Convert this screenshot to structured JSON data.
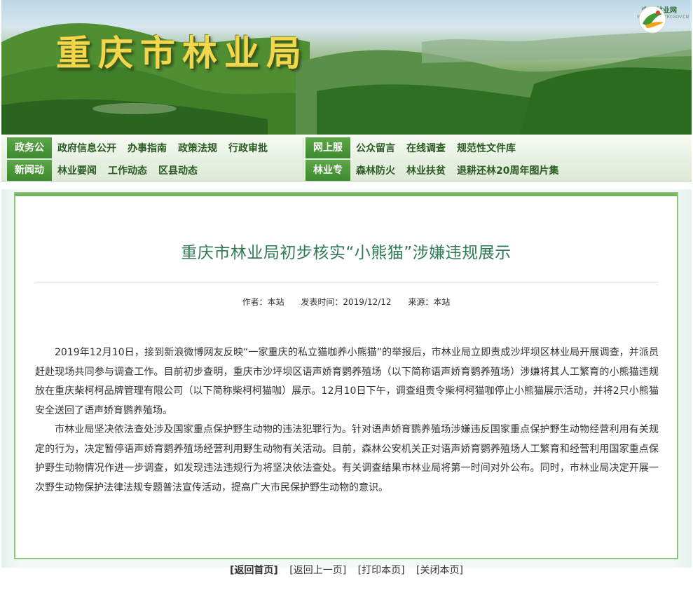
{
  "site": {
    "title": "重庆市林业局",
    "logo_name": "中国林业网",
    "logo_sub": "WWW.FORESTRY.GOV.CN"
  },
  "nav": {
    "row1": {
      "left_tag": "政务公开",
      "left_links": [
        "政府信息公开",
        "办事指南",
        "政策法规",
        "行政审批"
      ],
      "right_tag": "网上服务",
      "right_links": [
        "公众留言",
        "在线调查",
        "规范性文件库"
      ]
    },
    "row2": {
      "left_tag": "新闻动态",
      "left_links": [
        "林业要闻",
        "工作动态",
        "区县动态"
      ],
      "right_tag": "林业专题",
      "right_links": [
        "森林防火",
        "林业扶贫",
        "退耕还林20周年图片集"
      ]
    }
  },
  "article": {
    "title": "重庆市林业局初步核实“小熊猫”涉嫌违规展示",
    "author": "作者：本站",
    "date": "发表时间：2019/12/12",
    "source": "来源：本站",
    "paragraphs": [
      "2019年12月10日，接到新浪微博网友反映“一家重庆的私立猫咖养小熊猫”的举报后，市林业局立即责成沙坪坝区林业局开展调查，并派员赶赴现场共同参与调查工作。目前初步查明，重庆市沙坪坝区语声娇育鹦养殖场（以下简称语声娇育鹦养殖场）涉嫌将其人工繁育的小熊猫违规放在重庆柴柯柯品牌管理有限公司（以下简称柴柯柯猫咖）展示。12月10日下午，调查组责令柴柯柯猫咖停止小熊猫展示活动，并将2只小熊猫安全送回了语声娇育鹦养殖场。",
      "市林业局坚决依法查处涉及国家重点保护野生动物的违法犯罪行为。针对语声娇育鹦养殖场涉嫌违反国家重点保护野生动物经营利用有关规定的行为，决定暂停语声娇育鹦养殖场经营利用野生动物有关活动。目前，森林公安机关正对语声娇育鹦养殖场人工繁育和经营利用国家重点保护野生动物情况作进一步调查，如发现违法违规行为将坚决依法查处。有关调查结果市林业局将第一时间对外公布。同时，市林业局决定开展一次野生动物保护法律法规专题普法宣传活动，提高广大市民保护野生动物的意识。"
    ]
  },
  "footer": {
    "home": "[返回首页]",
    "back": "[返回上一页]",
    "print": "[打印本页]",
    "close": "[关闭本页]"
  },
  "colors": {
    "accent_green": "#3b8a2d",
    "title_green": "#2f7a55",
    "banner_title": "#f2d64b"
  }
}
